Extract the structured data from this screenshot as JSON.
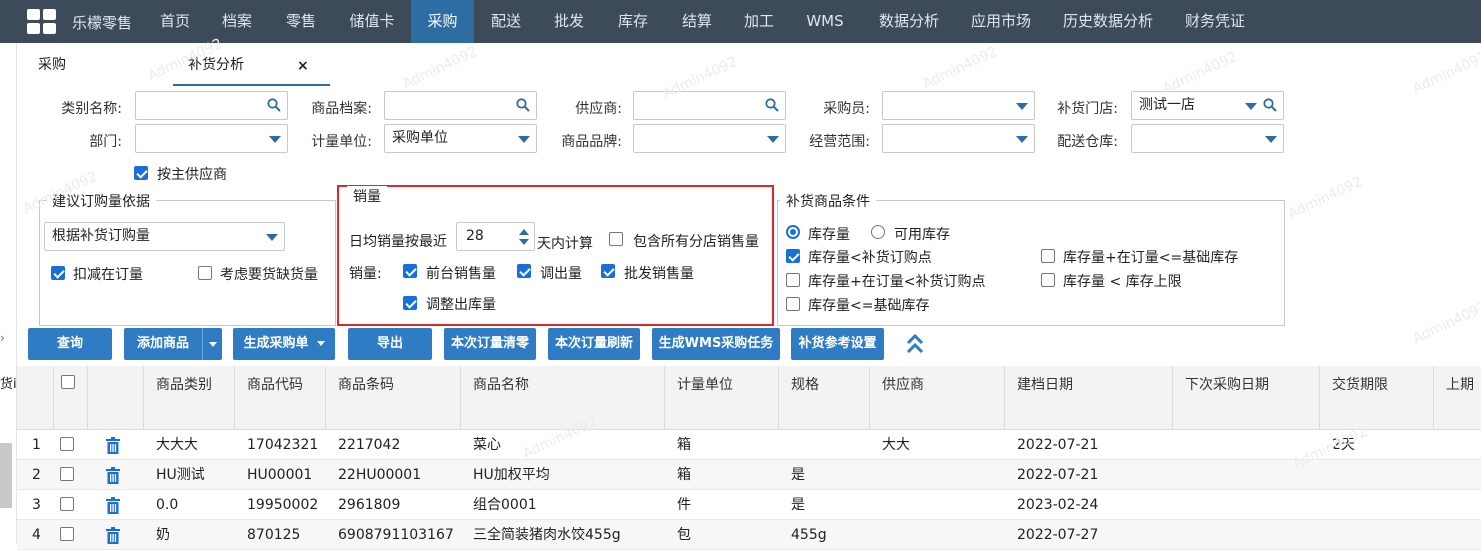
{
  "topbar": {
    "brand": "乐檬零售",
    "nav": [
      "首页",
      "档案",
      "零售",
      "储值卡",
      "采购",
      "配送",
      "批发",
      "库存",
      "结算",
      "加工",
      "WMS",
      "数据分析",
      "应用市场",
      "历史数据分析",
      "财务凭证"
    ],
    "active_index": 4
  },
  "tabs": [
    {
      "label": "采购"
    },
    {
      "label": "补货分析",
      "close": "×"
    }
  ],
  "filters": {
    "category_label": "类别名称:",
    "product_file_label": "商品档案:",
    "supplier_label": "供应商:",
    "buyer_label": "采购员:",
    "store_label": "补货门店:",
    "store_value": "测试一店",
    "department_label": "部门:",
    "unit_label": "计量单位:",
    "unit_value": "采购单位",
    "brand_label": "商品品牌:",
    "scope_label": "经营范围:",
    "warehouse_label": "配送仓库:",
    "by_main_supplier": "按主供应商"
  },
  "order_basis": {
    "legend": "建议订购量依据",
    "select_value": "根据补货订购量",
    "deduct_in_order": "扣减在订量",
    "consider_shortage": "考虑要货缺货量"
  },
  "sales": {
    "legend": "销量",
    "avg_prefix": "日均销量按最近",
    "days_value": "28",
    "avg_suffix": "天内计算",
    "include_branches": "包含所有分店销售量",
    "sales_label": "销量:",
    "front_sales": "前台销售量",
    "transfer_out": "调出量",
    "wholesale_sales": "批发销售量",
    "adjust_out": "调整出库量"
  },
  "conditions": {
    "legend": "补货商品条件",
    "radio_stock": "库存量",
    "radio_available": "可用库存",
    "c1": "库存量<补货订购点",
    "c2": "库存量+在订量<=基础库存",
    "c3": "库存量+在订量<补货订购点",
    "c4": "库存量 < 库存上限",
    "c5": "库存量<=基础库存"
  },
  "buttons": {
    "query": "查询",
    "add_product": "添加商品",
    "generate_po": "生成采购单",
    "export": "导出",
    "clear_order": "本次订量清零",
    "refresh_order": "本次订量刷新",
    "wms_task": "生成WMS采购任务",
    "settings": "补货参考设置"
  },
  "table": {
    "headers": [
      "商品类别",
      "商品代码",
      "商品条码",
      "商品名称",
      "计量单位",
      "规格",
      "供应商",
      "建档日期",
      "下次采购日期",
      "交货期限",
      "上期"
    ],
    "rows": [
      {
        "no": "1",
        "category": "大大大",
        "code": "17042321",
        "barcode": "2217042",
        "name": "菜心",
        "unit": "箱",
        "spec": "",
        "supplier": "大大",
        "created": "2022-07-21",
        "next": "",
        "lead": "2天"
      },
      {
        "no": "2",
        "category": "HU测试",
        "code": "HU00001",
        "barcode": "22HU00001",
        "name": "HU加权平均",
        "unit": "箱",
        "spec": "是",
        "supplier": "",
        "created": "2022-07-21",
        "next": "",
        "lead": ""
      },
      {
        "no": "3",
        "category": "0.0",
        "code": "19950002",
        "barcode": "2961809",
        "name": "组合0001",
        "unit": "件",
        "spec": "是",
        "supplier": "",
        "created": "2023-02-24",
        "next": "",
        "lead": ""
      },
      {
        "no": "4",
        "category": "奶",
        "code": "870125",
        "barcode": "6908791103167",
        "name": "三全简装猪肉水饺455g",
        "unit": "包",
        "spec": "455g",
        "supplier": "",
        "created": "2022-07-27",
        "next": "",
        "lead": ""
      }
    ]
  },
  "side": {
    "text": "货i"
  },
  "watermark": "Admin4092",
  "colors": {
    "topbar": "#3c4a5a",
    "nav_active": "#2e6da4",
    "button": "#2f7cc4",
    "highlight": "#e0252b",
    "check": "#1a6fd6"
  }
}
